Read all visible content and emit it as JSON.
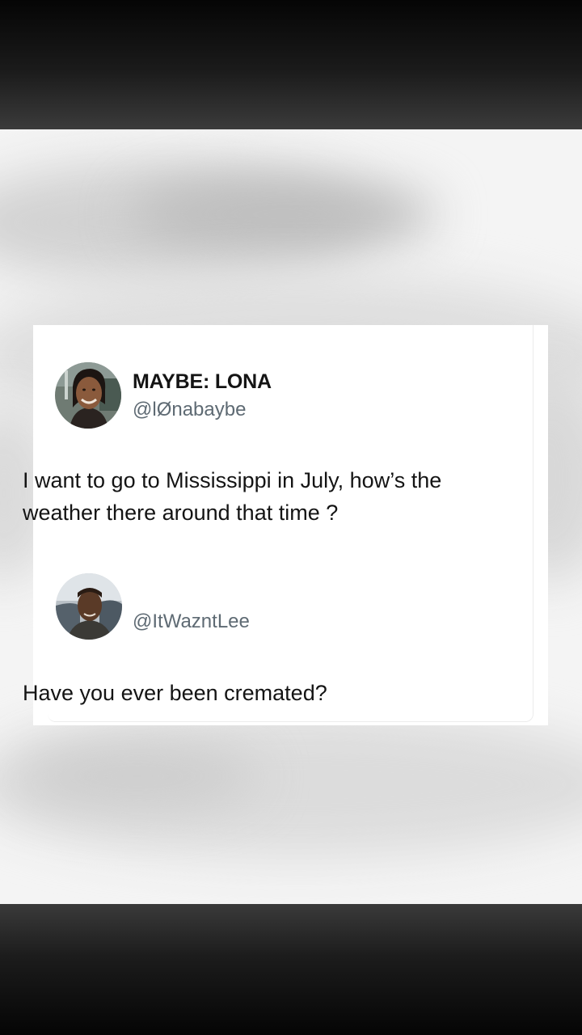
{
  "post1": {
    "display_name": "MAYBE: LONA",
    "handle": "@lØnabaybe",
    "text": "I want to go to Mississippi in July, how’s the weather there around that time ?"
  },
  "post2": {
    "handle": "@ItWazntLee",
    "text": "Have you ever been cremated?"
  },
  "icons": {
    "avatar1": "profile-photo",
    "avatar2": "profile-photo"
  },
  "colors": {
    "text_primary": "#141414",
    "text_secondary": "#5e6a73",
    "card_bg": "#ffffff"
  }
}
